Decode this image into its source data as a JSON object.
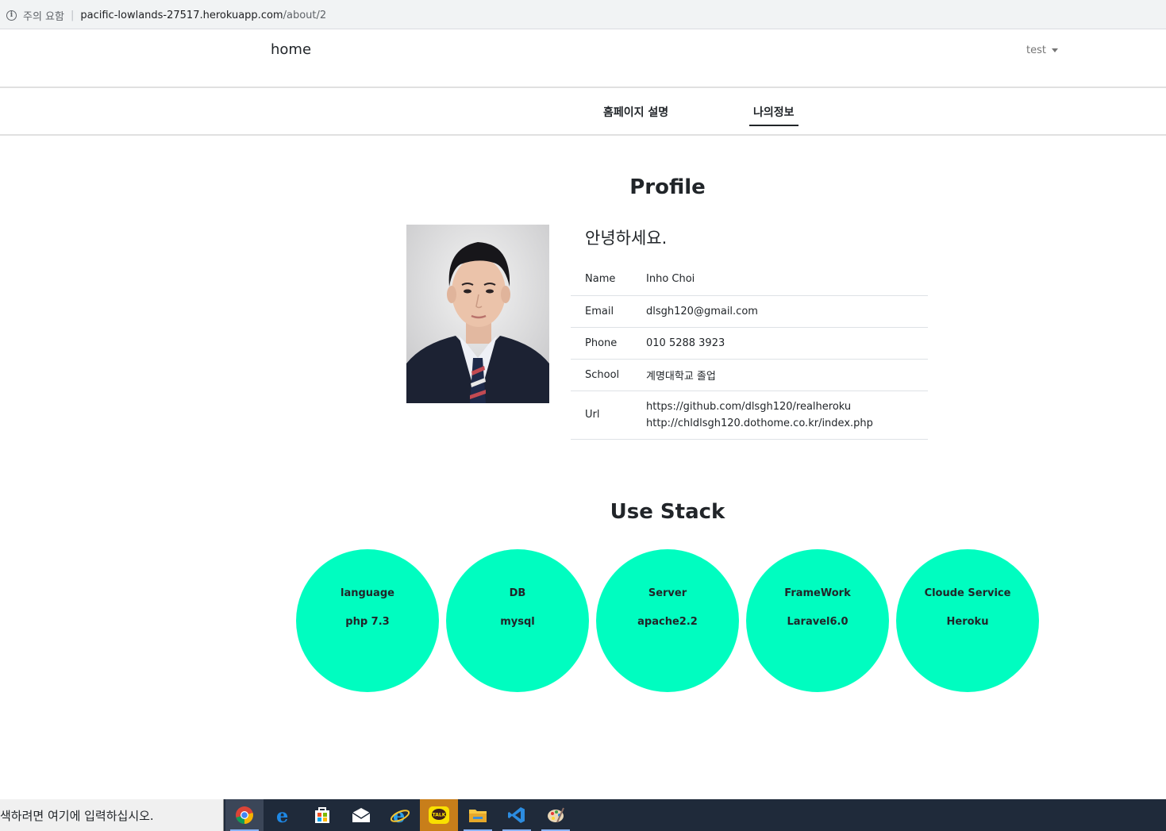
{
  "browser": {
    "security_warning": "주의 요함",
    "url_host": "pacific-lowlands-27517.herokuapp.com",
    "url_path": "/about/2"
  },
  "navbar": {
    "brand": "home",
    "user": "test"
  },
  "tabs": [
    {
      "label": "홈페이지 설명",
      "active": false
    },
    {
      "label": "나의정보",
      "active": true
    }
  ],
  "profile": {
    "title": "Profile",
    "greeting": "안녕하세요.",
    "rows": [
      {
        "key": "Name",
        "value": "Inho Choi"
      },
      {
        "key": "Email",
        "value": "dlsgh120@gmail.com"
      },
      {
        "key": "Phone",
        "value": "010 5288 3923"
      },
      {
        "key": "School",
        "value": "계명대학교 졸업"
      }
    ],
    "url_row": {
      "key": "Url",
      "values": [
        "https://github.com/dlsgh120/realheroku",
        "http://chldlsgh120.dothome.co.kr/index.php"
      ]
    }
  },
  "stack": {
    "title": "Use Stack",
    "circle_color": "#00fdc0",
    "items": [
      {
        "label": "language",
        "value": "php 7.3"
      },
      {
        "label": "DB",
        "value": "mysql"
      },
      {
        "label": "Server",
        "value": "apache2.2"
      },
      {
        "label": "FrameWork",
        "value": "Laravel6.0"
      },
      {
        "label": "Cloude Service",
        "value": "Heroku"
      }
    ]
  },
  "taskbar": {
    "search_placeholder": "색하려면 여기에 입력하십시오.",
    "kakao_label": "TALK",
    "apps": [
      "chrome-icon",
      "edge-icon",
      "store-icon",
      "mail-icon",
      "ie-icon",
      "kakaotalk-icon",
      "file-explorer-icon",
      "vscode-icon",
      "paint-icon"
    ]
  }
}
